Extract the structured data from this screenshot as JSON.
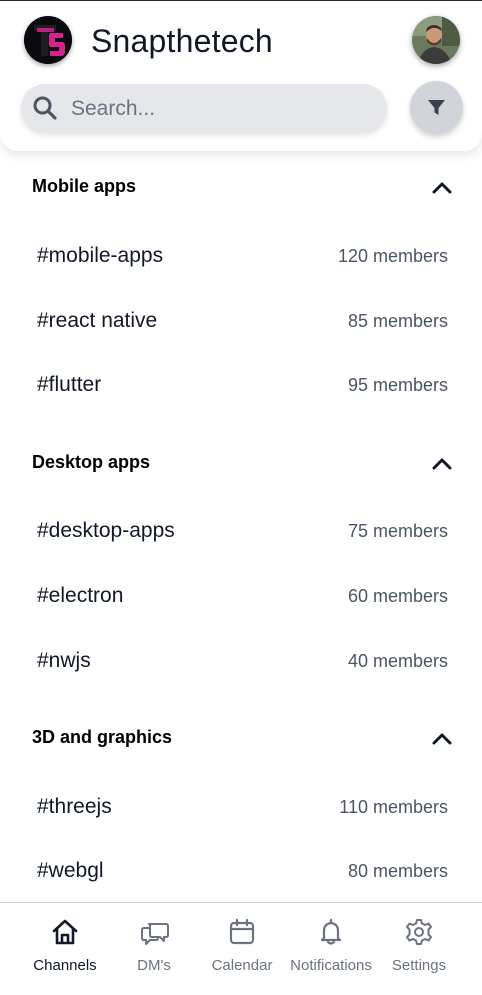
{
  "app": {
    "title": "Snapthetech",
    "logo_icon": "snapthetech-logo",
    "avatar_icon": "user-avatar"
  },
  "search": {
    "placeholder": "Search...",
    "value": ""
  },
  "filter": {
    "icon": "filter-icon"
  },
  "sections": [
    {
      "title": "Mobile apps",
      "expanded": true,
      "channels": [
        {
          "name": "#mobile-apps",
          "members": "120 members"
        },
        {
          "name": "#react native",
          "members": "85 members"
        },
        {
          "name": "#flutter",
          "members": "95 members"
        }
      ]
    },
    {
      "title": "Desktop apps",
      "expanded": true,
      "channels": [
        {
          "name": "#desktop-apps",
          "members": "75 members"
        },
        {
          "name": "#electron",
          "members": "60 members"
        },
        {
          "name": "#nwjs",
          "members": "40 members"
        }
      ]
    },
    {
      "title": "3D and graphics",
      "expanded": true,
      "channels": [
        {
          "name": "#threejs",
          "members": "110 members"
        },
        {
          "name": "#webgl",
          "members": "80 members"
        }
      ]
    }
  ],
  "nav": [
    {
      "label": "Channels",
      "icon": "home-icon",
      "active": true
    },
    {
      "label": "DM's",
      "icon": "chat-bubbles-icon",
      "active": false
    },
    {
      "label": "Calendar",
      "icon": "calendar-icon",
      "active": false
    },
    {
      "label": "Notifications",
      "icon": "bell-icon",
      "active": false
    },
    {
      "label": "Settings",
      "icon": "gear-icon",
      "active": false
    }
  ],
  "colors": {
    "logo_accent": "#d6218f",
    "active_icon": "#111827",
    "inactive_icon": "#6b7280",
    "search_bg": "#e5e7eb"
  }
}
